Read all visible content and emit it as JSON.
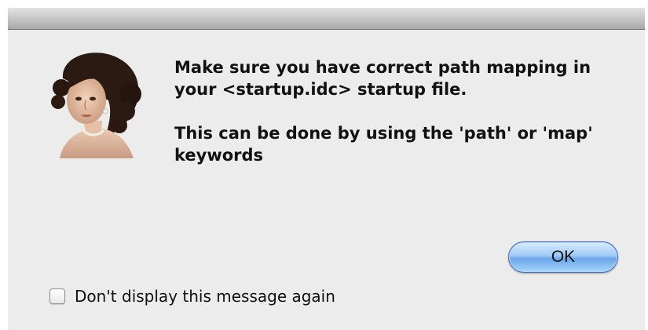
{
  "dialog": {
    "message_paragraphs": [
      "Make sure you have correct path mapping in your <startup.idc> startup file.",
      "This can be done by using the 'path' or 'map' keywords"
    ],
    "ok_label": "OK",
    "checkbox_label": "Don't display this message again",
    "checkbox_checked": false,
    "icon": "portrait-icon"
  },
  "colors": {
    "dialog_background": "#ececec",
    "button_accent": "#6aa7ea"
  }
}
